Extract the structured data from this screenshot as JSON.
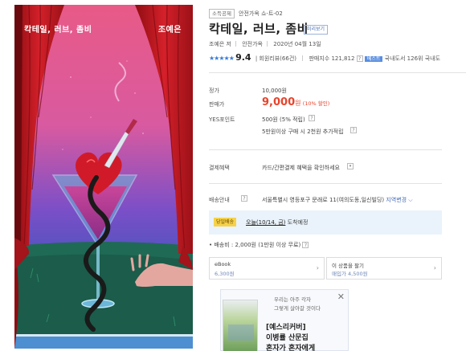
{
  "cover": {
    "title": "칵테일, 러브, 좀비",
    "author": "조예은"
  },
  "product": {
    "badges": [
      "소득공제"
    ],
    "series": "안전가옥 쇼-트-02",
    "title": "칵테일, 러브, 좀비",
    "preview_label": "미리보기",
    "author": "조예은 저",
    "publisher": "안전가옥",
    "date": "2020년 04월 13일",
    "rating": "9.4",
    "review_count": "회원리뷰(66건)",
    "sales_index": "판매지수 121,812",
    "bestseller_tag": "베스트",
    "rank": "국내도서 126위",
    "rank2": "국내도"
  },
  "price": {
    "list_label": "정가",
    "list_value": "10,000원",
    "sale_label": "판매가",
    "sale_value": "9,000",
    "sale_unit": "원",
    "discount": "(10% 할인)",
    "points_label": "YES포인트",
    "points_value": "500원 (5% 적립)",
    "points_extra": "5만원이상 구매 시 2천원 추가적립"
  },
  "benefit": {
    "label": "결제혜택",
    "value": "카드/간편결제 혜택을 확인하세요"
  },
  "shipping": {
    "label": "배송안내",
    "address": "서울특별시 영등포구 문래로 11(여의도동,일신빌딩)",
    "change_link": "지역변경",
    "tag": "당일배송",
    "today_prefix": "오늘",
    "today_date": "(10/14, 금)",
    "today_suffix": "도착예정",
    "fee": "배송비 : 2,000원 (1만원 이상 무료)"
  },
  "options": [
    {
      "title": "eBook",
      "sub": "6,300원"
    },
    {
      "title": "이 상품을 팔기",
      "sub": "매입가 4,500원"
    }
  ],
  "ad": {
    "line1": "우리는 아주 각자",
    "line2": "그렇게 살아갈 것이다",
    "headline1": "[예스리커버]",
    "headline2": "이병률 산문집",
    "headline3": "혼자가 혼자에게"
  },
  "colors": {
    "sale": "#e8432b",
    "accent_blue": "#3a7bd5",
    "delivery_bg": "#eaf3fb"
  }
}
